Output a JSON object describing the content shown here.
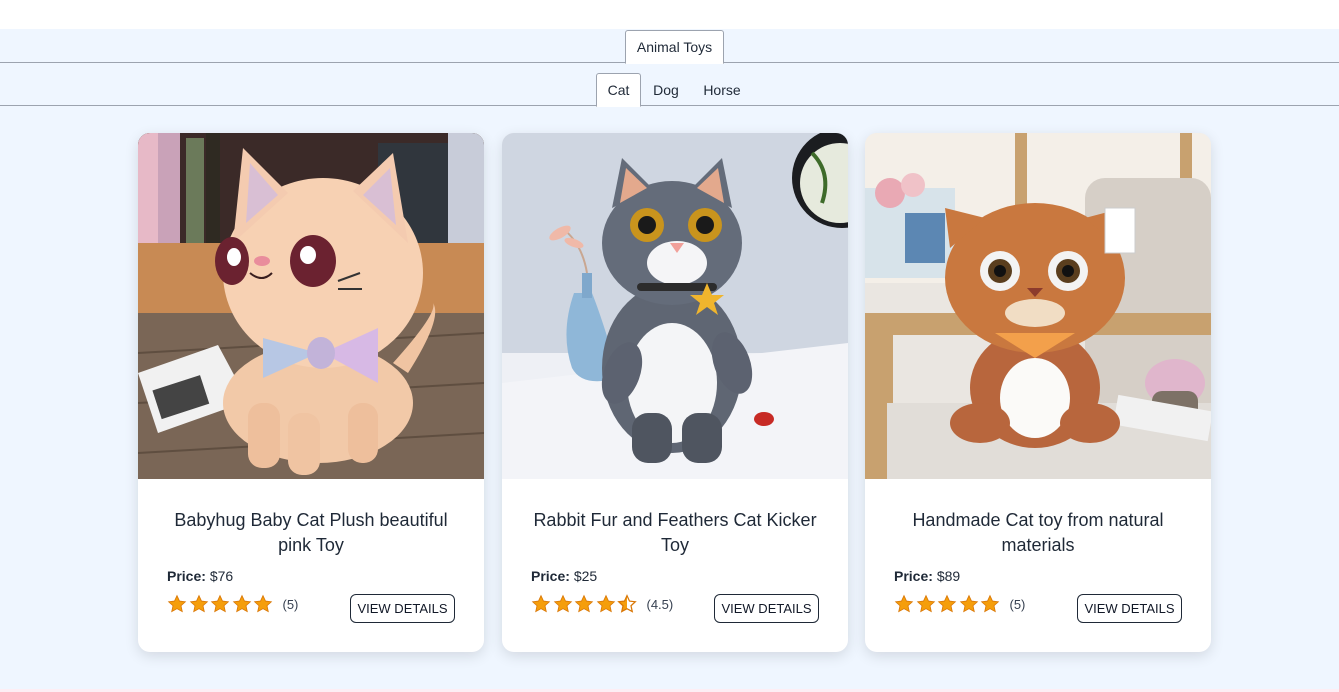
{
  "category_tabs": [
    {
      "label": "Animal Toys",
      "active": true
    }
  ],
  "sub_tabs": [
    {
      "label": "Cat",
      "active": true
    },
    {
      "label": "Dog",
      "active": false
    },
    {
      "label": "Horse",
      "active": false
    }
  ],
  "products": [
    {
      "title": "Babyhug Baby Cat Plush beautiful pink Toy",
      "price_label": "Price:",
      "price": "$76",
      "rating": 5,
      "rating_text": "(5)",
      "button_label": "VIEW DETAILS",
      "image": "peach plush kitten with sparkly ears and rainbow bow tie on wooden floor"
    },
    {
      "title": "Rabbit Fur and Feathers Cat Kicker Toy",
      "price_label": "Price:",
      "price": "$25",
      "rating": 4.5,
      "rating_text": "(4.5)",
      "button_label": "VIEW DETAILS",
      "image": "grey fluffy cat plush with star collar standing on white table beside blue vase"
    },
    {
      "title": "Handmade Cat toy from natural materials",
      "price_label": "Price:",
      "price": "$89",
      "rating": 5,
      "rating_text": "(5)",
      "button_label": "VIEW DETAILS",
      "image": "orange tabby cat plush with polka-dot bandana sitting on a chair"
    }
  ],
  "colors": {
    "background": "#eff6ff",
    "star": "#f59e0b",
    "star_stroke": "#d97706",
    "tab_border": "#9ca3af"
  }
}
